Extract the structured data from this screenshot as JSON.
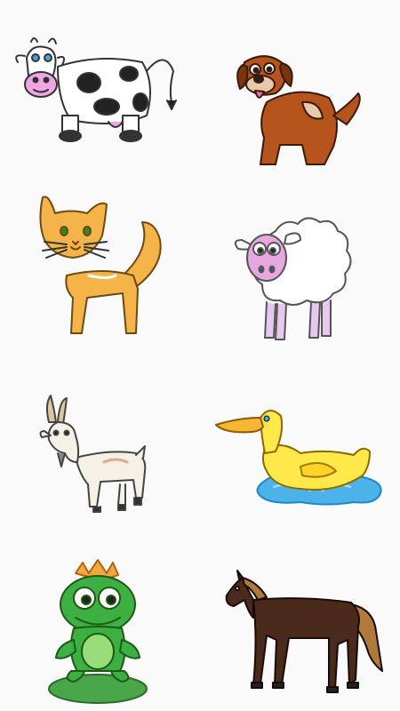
{
  "screen": {
    "background": "#fafafa"
  },
  "animals": [
    {
      "name": "cow",
      "icon": "cow-icon"
    },
    {
      "name": "dog",
      "icon": "dog-icon"
    },
    {
      "name": "cat",
      "icon": "cat-icon"
    },
    {
      "name": "sheep",
      "icon": "sheep-icon"
    },
    {
      "name": "goat",
      "icon": "goat-icon"
    },
    {
      "name": "duck",
      "icon": "duck-icon"
    },
    {
      "name": "frog",
      "icon": "frog-with-crown-icon"
    },
    {
      "name": "horse",
      "icon": "horse-icon"
    }
  ],
  "colors": {
    "cow_spots": "#222222",
    "cow_nose": "#f0a6e0",
    "dog_fur": "#b5541c",
    "cat_fur": "#f4b44a",
    "sheep_face": "#e7a8e0",
    "duck_body": "#ffe84a",
    "water": "#4bb3ea",
    "frog_body": "#3cb043",
    "crown": "#f4a83a",
    "horse_body": "#4a2a1a",
    "horse_mane": "#b07a3a"
  }
}
